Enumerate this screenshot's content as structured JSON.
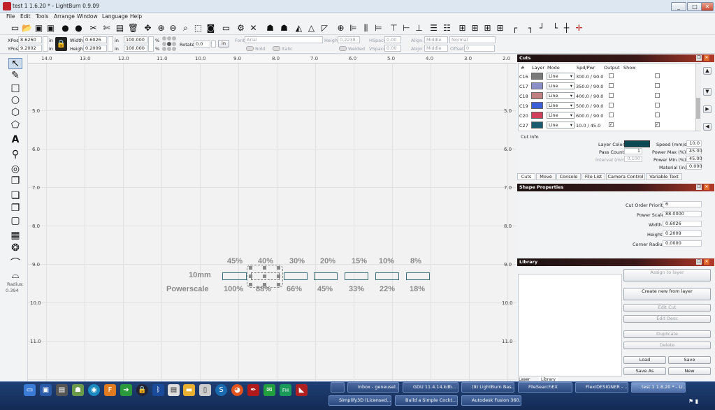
{
  "window": {
    "title": "test 1 1.6.20 * - LightBurn 0.9.09",
    "minimize": "_",
    "maximize": "□",
    "close": "✕"
  },
  "menu": [
    "File",
    "Edit",
    "Tools",
    "Arrange",
    "Window",
    "Language",
    "Help"
  ],
  "toolbar_icons": [
    "new-file",
    "open",
    "save",
    "save-as",
    "import",
    "export",
    "cut",
    "copy",
    "paste",
    "delete",
    "move",
    "zoom-in",
    "zoom-out",
    "zoom-frame",
    "select-frame",
    "camera",
    "monitor",
    "settings",
    "device-settings",
    "group",
    "ungroup",
    "mirror-h",
    "mirror-v",
    "rotate",
    "target",
    "align-left",
    "align-center-h",
    "align-right",
    "align-top",
    "align-center-v",
    "align-bottom",
    "distribute-h",
    "distribute-v",
    "move-tl",
    "move-tr",
    "move-bl",
    "move-br",
    "center"
  ],
  "props": {
    "xpos_label": "XPos",
    "xpos": "8.6260",
    "ypos_label": "YPos",
    "ypos": "9.2002",
    "width_label": "Width",
    "width": "0.6026",
    "height_label": "Height",
    "height": "0.2009",
    "unit": "in",
    "scale_w": "100.000",
    "scale_h": "100.000",
    "pct": "%",
    "rotate_label": "Rotate",
    "rotate": "0.0",
    "rot_unit_btn": "in",
    "font_label": "Font",
    "font": "Arial",
    "text_height_label": "Height",
    "text_height": "0.2238",
    "hspace_label": "HSpace",
    "hspace": "0.00",
    "vspace_label": "VSpace",
    "vspace": "0.00",
    "align_x_label": "Align X",
    "align_x": "Middle",
    "align_y_label": "Align Y",
    "align_y": "Middle",
    "normal": "Normal",
    "offset_label": "Offset",
    "offset": "0",
    "bold": "Bold",
    "italic": "Italic",
    "welded": "Welded"
  },
  "left_tools": [
    "select-tool",
    "draw-lines-tool",
    "rectangle-tool",
    "ellipse-tool",
    "polygon-tool",
    "shape-tool",
    "text-tool",
    "position-laser-tool",
    "offset-tool",
    "weld-tool",
    "boolean-union-tool",
    "boolean-subtract-tool",
    "boolean-intersect-tool",
    "grid-array-tool",
    "circular-array-tool",
    "node-edit-tool",
    "corner-tool"
  ],
  "radius": {
    "label": "Radius:",
    "value": "0.394"
  },
  "ruler_x": [
    "14.0",
    "13.0",
    "12.0",
    "11.0",
    "10.0",
    "9.0",
    "8.0",
    "7.0",
    "6.0",
    "5.0",
    "4.0",
    "3.0",
    "2.0"
  ],
  "ruler_y": [
    "5.0",
    "6.0",
    "7.0",
    "8.0",
    "9.0",
    "10.0",
    "11.0"
  ],
  "canvas_text": {
    "top_pct": [
      "45%",
      "40%",
      "30%",
      "20%",
      "15%",
      "10%",
      "8%"
    ],
    "row_label": "10mm",
    "scale_label": "Powerscale",
    "bottom_pct": [
      "100%",
      "88%",
      "66%",
      "45%",
      "33%",
      "22%",
      "18%"
    ]
  },
  "cuts": {
    "title": "Cuts",
    "headers": [
      "#",
      "Layer",
      "Mode",
      "Spd/Pwr",
      "Output",
      "Show"
    ],
    "rows": [
      {
        "id": "C16",
        "color": "#7a7a7a",
        "mode": "Line",
        "spd": "300.0 / 90.0",
        "output": "",
        "show": ""
      },
      {
        "id": "C17",
        "color": "#8a8fc7",
        "mode": "Line",
        "spd": "350.0 / 90.0",
        "output": "",
        "show": ""
      },
      {
        "id": "C18",
        "color": "#c08080",
        "mode": "Line",
        "spd": "400.0 / 90.0",
        "output": "",
        "show": ""
      },
      {
        "id": "C19",
        "color": "#3a5fd8",
        "mode": "Line",
        "spd": "500.0 / 90.0",
        "output": "",
        "show": ""
      },
      {
        "id": "C20",
        "color": "#d0405a",
        "mode": "Line",
        "spd": "600.0 / 90.0",
        "output": "",
        "show": ""
      },
      {
        "id": "C27",
        "color": "#1a5a6e",
        "mode": "Line",
        "spd": "10.0 / 45.0",
        "output": "✓",
        "show": "✓"
      }
    ],
    "cut_info": "Cut Info",
    "layer_color_label": "Layer Color",
    "layer_color": "#0e4a56",
    "speed_label": "Speed (mm/s)",
    "speed": "10.0",
    "pass_label": "Pass Count",
    "pass": "1",
    "pmax_label": "Power Max (%)",
    "pmax": "45.00",
    "interval_label": "Interval (mm)",
    "interval": "0.100",
    "pmin_label": "Power Min (%)",
    "pmin": "45.00",
    "material_label": "Material (in)",
    "material": "0.000",
    "tabs": [
      "Cuts",
      "Move",
      "Console",
      "File List",
      "Camera Control",
      "Variable Text"
    ]
  },
  "shape": {
    "title": "Shape Properties",
    "cop_label": "Cut Order Priority",
    "cop": "6",
    "ps_label": "Power Scale",
    "ps": "88.0000",
    "w_label": "Width",
    "w": "0.6026",
    "h_label": "Height",
    "h": "0.2009",
    "cr_label": "Corner Radius",
    "cr": "0.0000"
  },
  "library": {
    "title": "Library",
    "assign": "Assign to layer",
    "create": "Create new from layer",
    "edit_cut": "Edit Cut",
    "edit_desc": "Edit Desc",
    "duplicate": "Duplicate",
    "delete": "Delete",
    "load": "Load",
    "save": "Save",
    "save_as": "Save As",
    "new": "New",
    "tabs": [
      "Laser",
      "Library"
    ]
  },
  "taskbar": {
    "row1": [
      "",
      "Inbox - geneusel...",
      "GDU 11.4.14.kdb...",
      "(9) LightBurn Bas...",
      "FileSearchEX",
      "FlexiDESIGNER - ...",
      "test 1 1.6.20 * - Li..."
    ],
    "row2": [
      "Simplify3D (Licensed...",
      "Build a Simple Cockt...",
      "Autodesk Fusion 360..."
    ]
  }
}
